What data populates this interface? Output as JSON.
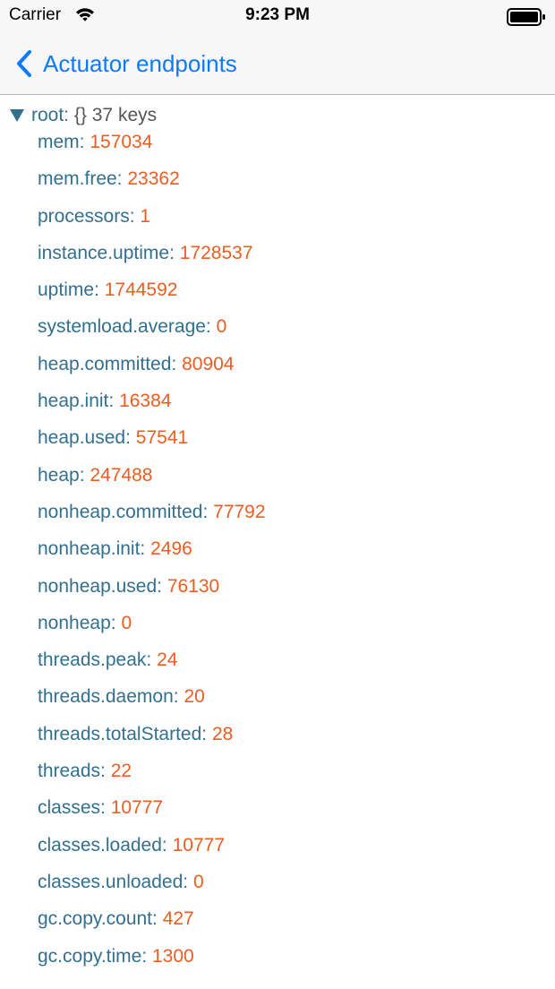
{
  "status_bar": {
    "carrier": "Carrier",
    "time": "9:23 PM",
    "wifi_icon": "wifi-icon",
    "battery_icon": "battery-full-icon"
  },
  "nav": {
    "back_label": "Actuator endpoints",
    "back_icon": "chevron-left-icon"
  },
  "colors": {
    "accent": "#0a7aff",
    "key": "#31708f",
    "number_value": "#eb5d21",
    "meta": "#555555",
    "bar_background": "#f7f7f7"
  },
  "tree": {
    "root_key": "root:",
    "root_type": "{}",
    "root_count": "37 keys",
    "expanded": true,
    "items": [
      {
        "key": "mem:",
        "value": "157034"
      },
      {
        "key": "mem.free:",
        "value": "23362"
      },
      {
        "key": "processors:",
        "value": "1"
      },
      {
        "key": "instance.uptime:",
        "value": "1728537"
      },
      {
        "key": "uptime:",
        "value": "1744592"
      },
      {
        "key": "systemload.average:",
        "value": "0"
      },
      {
        "key": "heap.committed:",
        "value": "80904"
      },
      {
        "key": "heap.init:",
        "value": "16384"
      },
      {
        "key": "heap.used:",
        "value": "57541"
      },
      {
        "key": "heap:",
        "value": "247488"
      },
      {
        "key": "nonheap.committed:",
        "value": "77792"
      },
      {
        "key": "nonheap.init:",
        "value": "2496"
      },
      {
        "key": "nonheap.used:",
        "value": "76130"
      },
      {
        "key": "nonheap:",
        "value": "0"
      },
      {
        "key": "threads.peak:",
        "value": "24"
      },
      {
        "key": "threads.daemon:",
        "value": "20"
      },
      {
        "key": "threads.totalStarted:",
        "value": "28"
      },
      {
        "key": "threads:",
        "value": "22"
      },
      {
        "key": "classes:",
        "value": "10777"
      },
      {
        "key": "classes.loaded:",
        "value": "10777"
      },
      {
        "key": "classes.unloaded:",
        "value": "0"
      },
      {
        "key": "gc.copy.count:",
        "value": "427"
      },
      {
        "key": "gc.copy.time:",
        "value": "1300"
      }
    ]
  }
}
